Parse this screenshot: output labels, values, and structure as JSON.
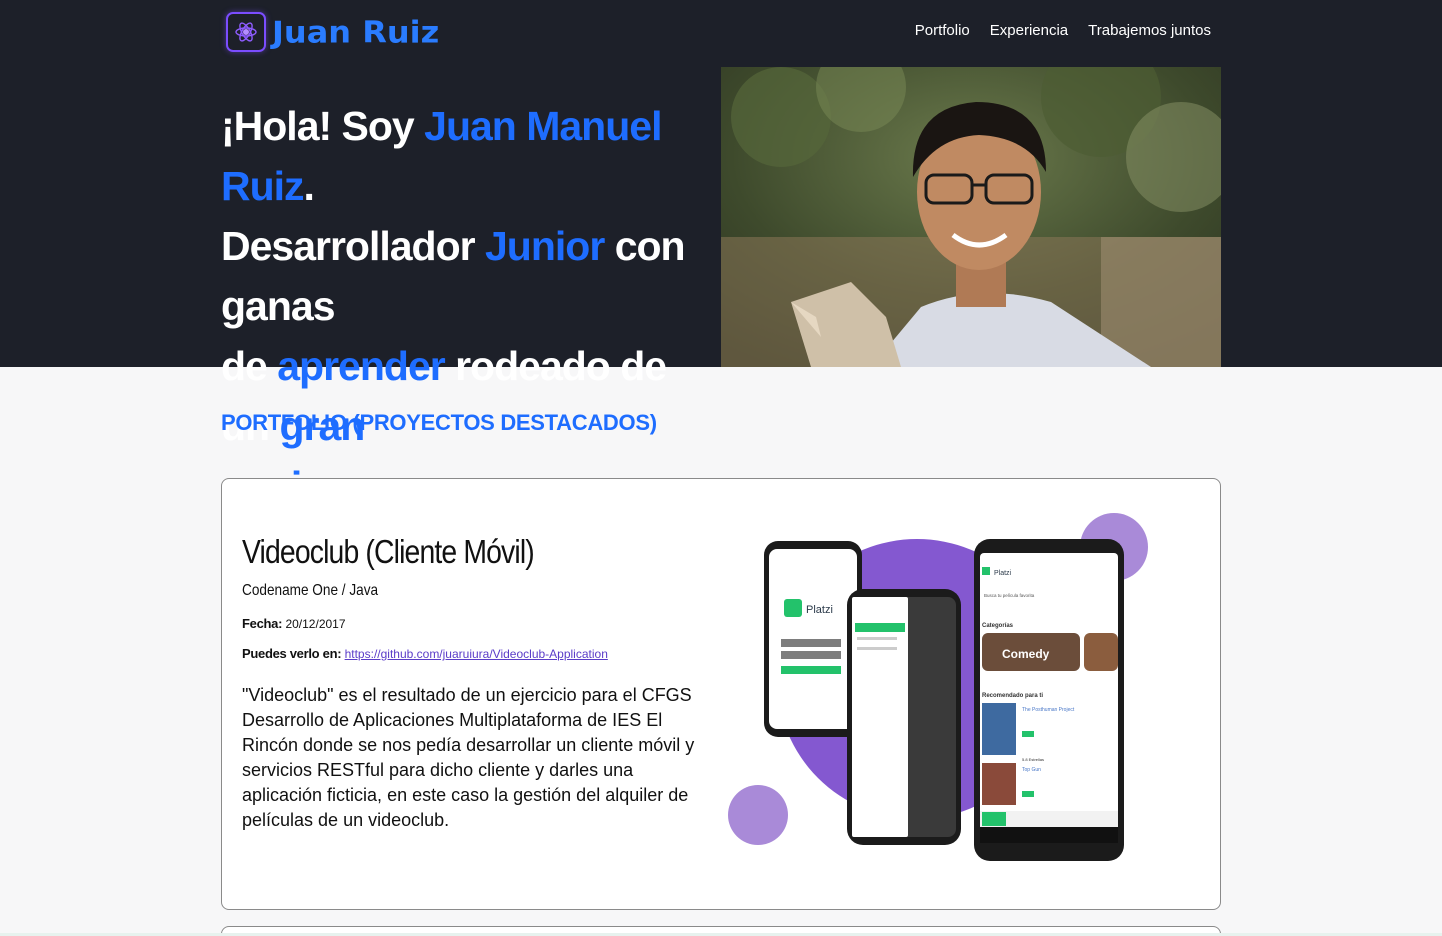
{
  "header": {
    "logo_text": "Juan Ruiz",
    "nav": [
      "Portfolio",
      "Experiencia",
      "Trabajemos juntos"
    ]
  },
  "hero": {
    "line1_a": "¡Hola! Soy ",
    "line1_name": "Juan Manuel Ruiz",
    "line1_b": ".",
    "line2_a": "Desarrollador ",
    "line2_hl": "Junior",
    "line2_b": " con ganas",
    "line3_a": "de ",
    "line3_hl": "aprender",
    "line3_b": " rodeado de un ",
    "line3_hl2": "gran",
    "line4_hl": "equipo"
  },
  "portfolio": {
    "title": "PORTFOLIO (PROYECTOS DESTACADOS)",
    "projects": [
      {
        "title": "Videoclub (Cliente Móvil)",
        "tech": "Codename One / Java",
        "date_label": "Fecha:",
        "date": "20/12/2017",
        "link_label": "Puedes verlo en:",
        "link": "https://github.com/juaruiura/Videoclub-Application",
        "description": "\"Videoclub\" es el resultado de un ejercicio para el CFGS Desarrollo de Aplicaciones Multiplataforma de IES El Rincón donde se nos pedía desarrollar un cliente móvil y servicios RESTful para dicho cliente y darles una aplicación ficticia, en este caso la gestión del alquiler de películas de un videoclub."
      }
    ]
  },
  "mockup": {
    "brand": "Platzi",
    "search_placeholder": "Busca tu película favorita",
    "categories_label": "Categorías",
    "category": "Comedy",
    "recommended_label": "Recomendado para ti",
    "movie1": "The Posthuman Project",
    "movie2": "Top Gun",
    "rating": "5.8 Estrellas"
  },
  "colors": {
    "accent": "#1e6dff",
    "hero_bg": "#1d2029",
    "purple": "#7b4dff"
  }
}
